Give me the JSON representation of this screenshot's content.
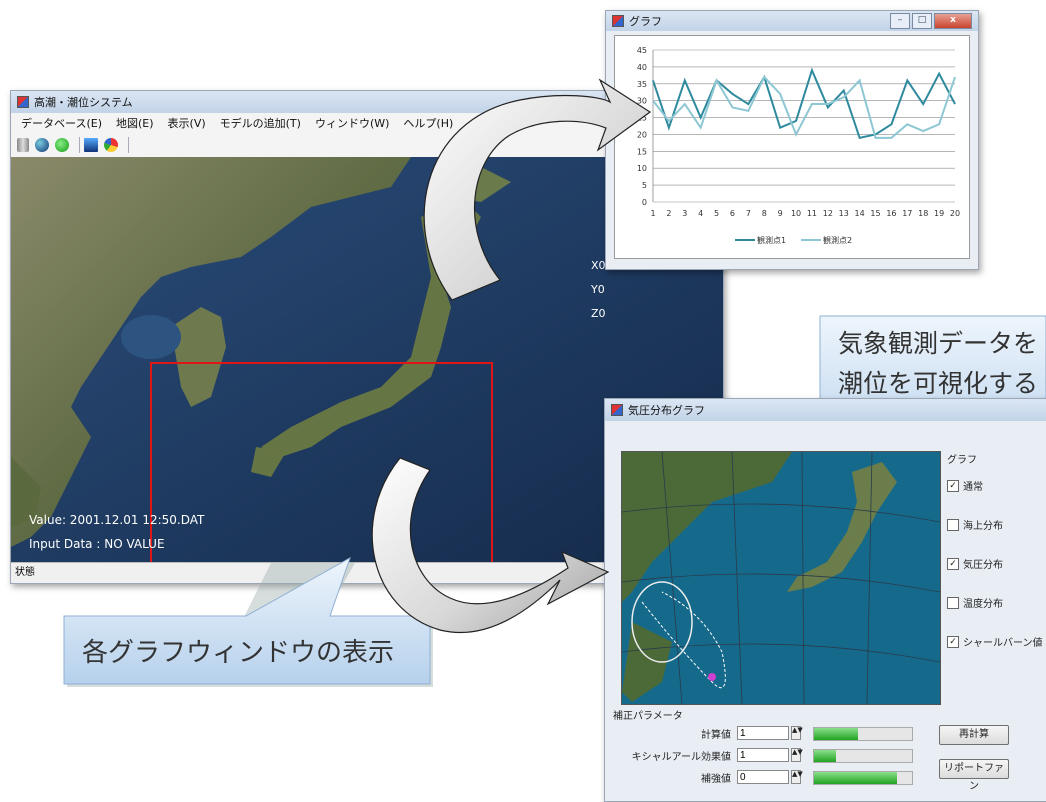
{
  "main_window": {
    "title": "高潮・潮位システム",
    "menu": [
      "データベース(E)",
      "地図(E)",
      "表示(V)",
      "モデルの追加(T)",
      "ウィンドウ(W)",
      "ヘルプ(H)"
    ],
    "map": {
      "value_text": "Value: 2001.12.01 12:50.DAT",
      "input_text": "Input Data : NO VALUE",
      "coords": [
        "X0",
        "Y0",
        "Z0"
      ]
    },
    "status": "状態"
  },
  "graph_window": {
    "title": "グラフ",
    "controls": [
      "–",
      "□",
      "x"
    ]
  },
  "chart_data": {
    "type": "line",
    "x": [
      1,
      2,
      3,
      4,
      5,
      6,
      7,
      8,
      9,
      10,
      11,
      12,
      13,
      14,
      15,
      16,
      17,
      18,
      19,
      20
    ],
    "ylim": [
      0,
      45
    ],
    "yticks": [
      0,
      5,
      10,
      15,
      20,
      25,
      30,
      35,
      40,
      45
    ],
    "grid": true,
    "legend_placement": "bottom",
    "series": [
      {
        "name": "観測点1",
        "color": "#2f8a9e",
        "values": [
          36,
          22,
          36,
          25,
          36,
          32,
          29,
          37,
          22,
          24,
          39,
          28,
          33,
          19,
          20,
          23,
          36,
          29,
          38,
          29
        ]
      },
      {
        "name": "観測点2",
        "color": "#8ec7d4",
        "values": [
          30,
          24,
          29,
          22,
          36,
          28,
          27,
          37,
          32,
          20,
          29,
          29,
          31,
          36,
          19,
          19,
          23,
          21,
          23,
          37
        ]
      }
    ]
  },
  "pressure_window": {
    "title": "気圧分布グラフ",
    "options_group": "グラフ",
    "options": [
      {
        "label": "通常",
        "checked": true
      },
      {
        "label": "海上分布",
        "checked": false
      },
      {
        "label": "気圧分布",
        "checked": true
      },
      {
        "label": "温度分布",
        "checked": false
      },
      {
        "label": "シャールバーン値",
        "checked": true
      }
    ],
    "params_group": "補正パラメータ",
    "params": [
      {
        "label": "計算値",
        "value": "1",
        "level": 0.45
      },
      {
        "label": "キシャルアール効果値",
        "value": "1",
        "level": 0.22
      },
      {
        "label": "補強値",
        "value": "0",
        "level": 0.85
      }
    ],
    "buttons": [
      "再計算",
      "リポートファン"
    ]
  },
  "callouts": {
    "graph_windows": "各グラフウィンドウの表示",
    "weather_line1": "気象観測データを",
    "weather_line2": "潮位を可視化する"
  }
}
